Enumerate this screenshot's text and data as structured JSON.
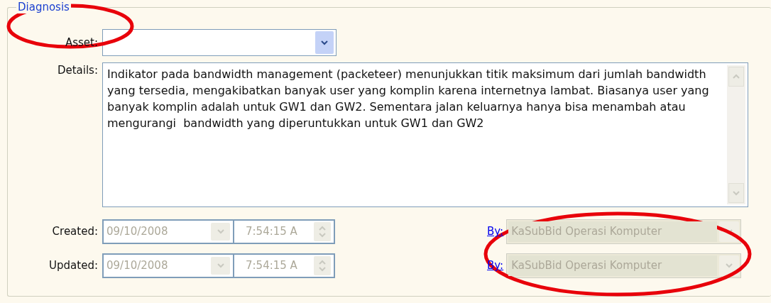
{
  "section": {
    "title": "Diagnosis",
    "highlighted": true
  },
  "asset": {
    "label": "Asset:"
  },
  "details": {
    "label": "Details:",
    "value": "Indikator pada bandwidth management (packeteer) menunjukkan titik maksimum dari jumlah bandwidth yang tersedia, mengakibatkan banyak user yang komplin karena internetnya lambat. Biasanya user yang banyak komplin adalah untuk GW1 dan GW2. Sementara jalan keluarnya hanya bisa menambah atau mengurangi  bandwidth yang diperuntukkan untuk GW1 dan GW2"
  },
  "stamps": [
    {
      "label": "Created:",
      "date": "09/10/2008",
      "time": "7:54:15 A",
      "by_link": "By:",
      "by": "KaSubBid Operasi Komputer",
      "disabled": true
    },
    {
      "label": "Updated:",
      "date": "09/10/2008",
      "time": "7:54:15 A",
      "by_link": "By:",
      "by": "KaSubBid Operasi Komputer",
      "disabled": true
    }
  ],
  "by_fields_highlighted": true
}
